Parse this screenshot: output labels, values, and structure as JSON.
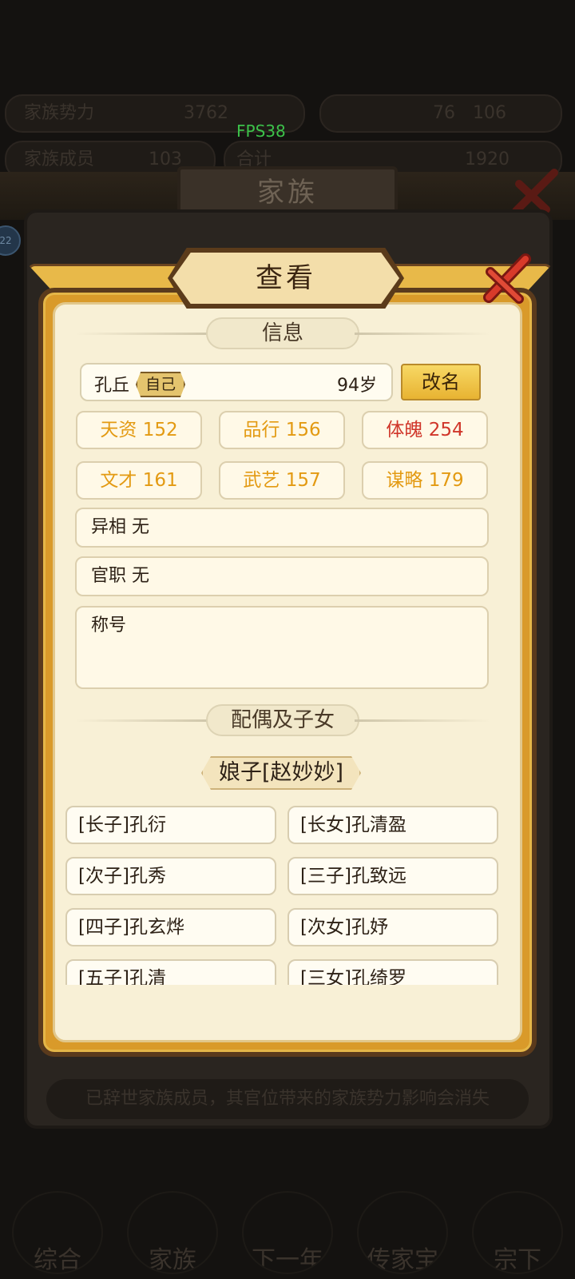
{
  "overlay": {
    "fps": "FPS38"
  },
  "background": {
    "title": "家族",
    "left_badge": "22",
    "footer_notice": "已辞世家族成员，其官位带来的家族势力影响会消失",
    "stat_row1": {
      "label_left": "家族势力",
      "value_left": "3762",
      "value_mid": "76",
      "value_right": "106"
    },
    "stat_row2": {
      "label_left": "家族成员",
      "value_left": "103",
      "value_mid": "合计",
      "value_right": "1920"
    },
    "nav": [
      "综合",
      "家族",
      "下一年",
      "传家宝",
      "宗下"
    ]
  },
  "dialog": {
    "title": "查看",
    "info_section": "信息",
    "name": "孔丘",
    "self_tag": "自己",
    "age": "94岁",
    "rename_button": "改名",
    "stats": [
      {
        "text": "天资 152",
        "color": "#e39a12"
      },
      {
        "text": "品行 156",
        "color": "#e39a12"
      },
      {
        "text": "体魄 254",
        "color": "#d0362a"
      },
      {
        "text": "文才 161",
        "color": "#e39a12"
      },
      {
        "text": "武艺 157",
        "color": "#e39a12"
      },
      {
        "text": "谋略 179",
        "color": "#e39a12"
      }
    ],
    "traits": "异相 无",
    "office": "官职 无",
    "titles_label": "称号",
    "family_section": "配偶及子女",
    "spouse": "娘子[赵妙妙]",
    "children": [
      "[长子]孔衍",
      "[长女]孔清盈",
      "[次子]孔秀",
      "[三子]孔致远",
      "[四子]孔玄烨",
      "[次女]孔妤",
      "[五子]孔清",
      "[三女]孔绮罗"
    ]
  }
}
